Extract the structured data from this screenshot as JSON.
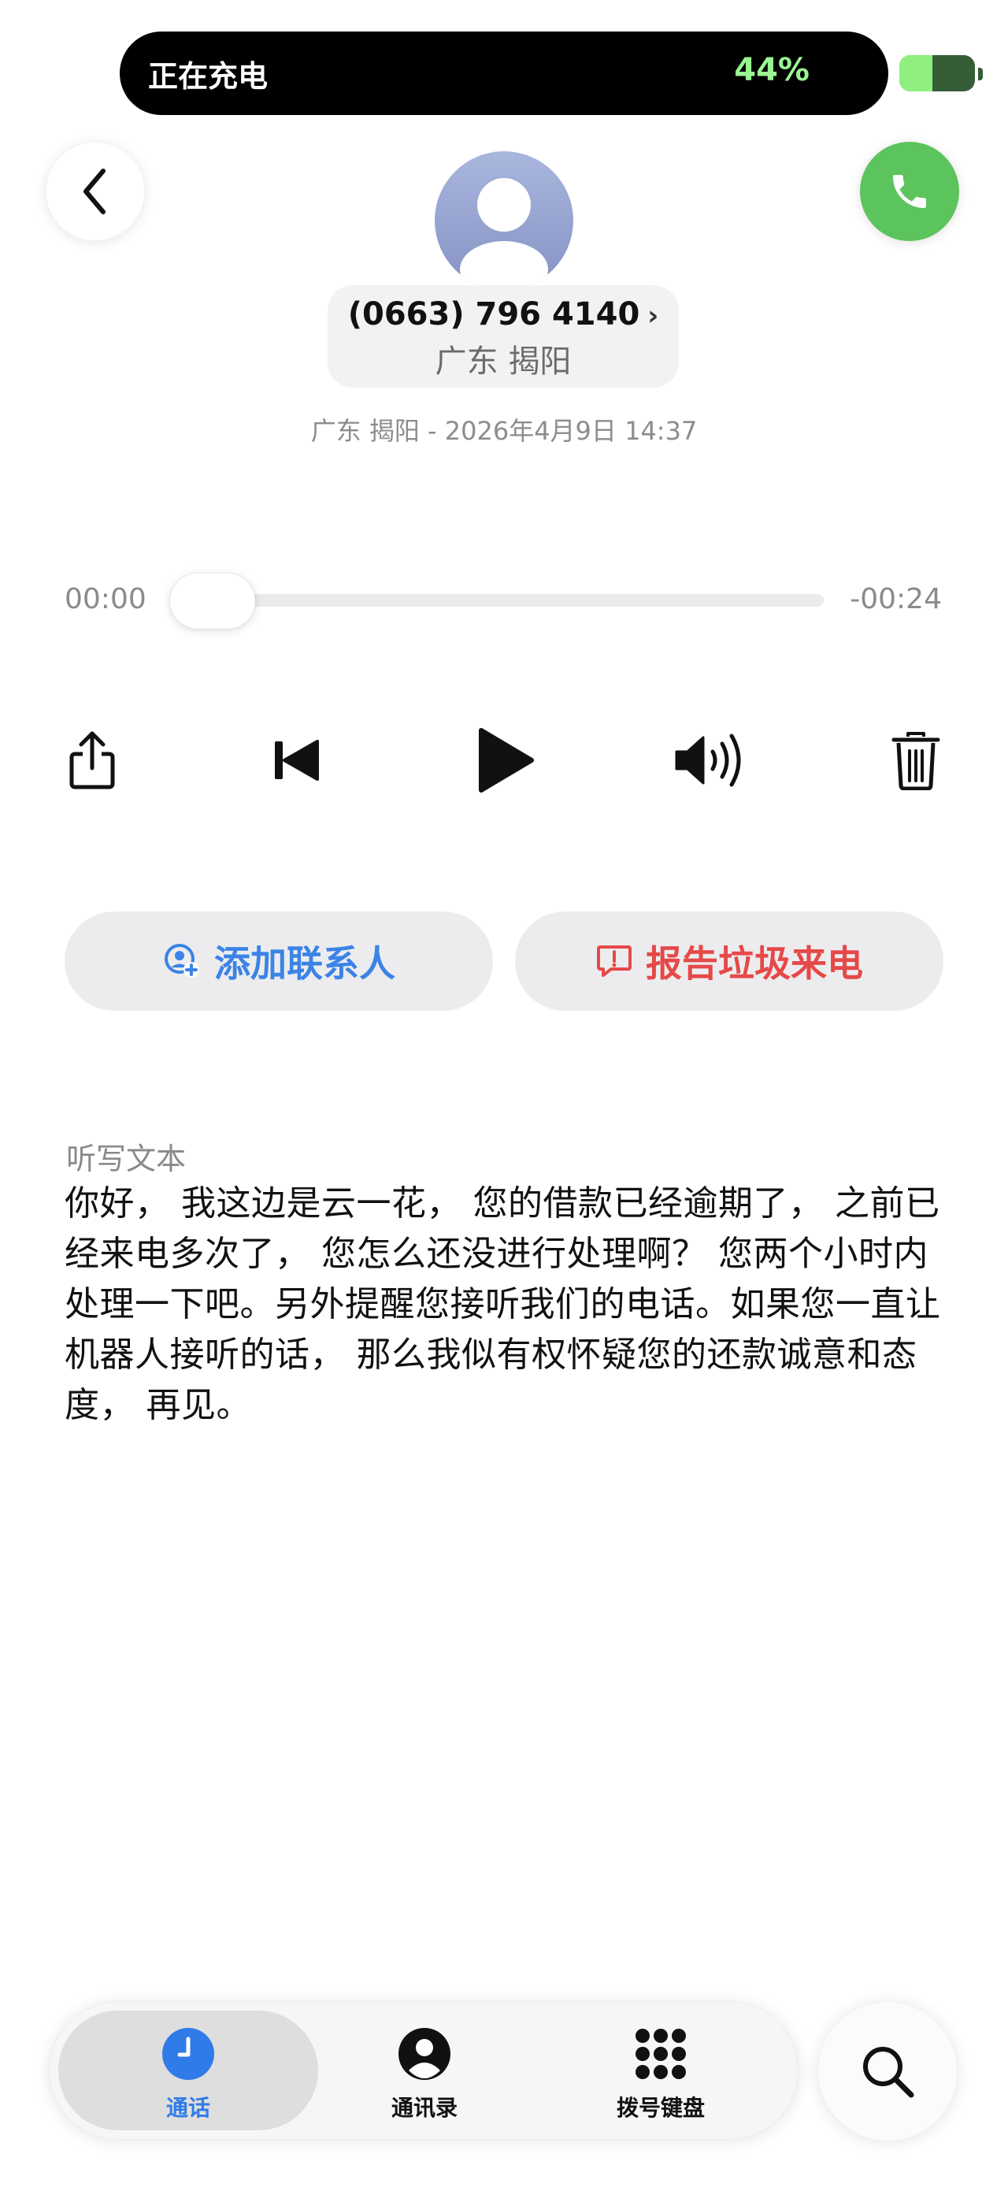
{
  "status": {
    "charging_label": "正在充电",
    "battery_percent_label": "44%",
    "battery_level": 0.44,
    "battery_color": "#8ff07f"
  },
  "header": {
    "back_icon": "chevron-left-icon",
    "call_icon": "phone-icon",
    "call_button_color": "#5cc45c"
  },
  "caller": {
    "avatar_icon": "person-silhouette-icon",
    "number": "(0663) 796 4140",
    "number_chevron": "›",
    "location": "广东 揭阳",
    "meta": "广东 揭阳 - 2026年4月9日 14:37"
  },
  "player": {
    "elapsed": "00:00",
    "remaining": "-00:24",
    "progress": 0,
    "controls": [
      "share-icon",
      "skip-back-icon",
      "play-icon",
      "speaker-icon",
      "trash-icon"
    ]
  },
  "actions": {
    "add_contact": "添加联系人",
    "add_contact_color": "#3b83e7",
    "report_spam": "报告垃圾来电",
    "report_spam_color": "#e64848"
  },
  "transcript": {
    "label": "听写文本",
    "text": "你好， 我这边是云一花， 您的借款已经逾期了， 之前已经来电多次了， 您怎么还没进行处理啊？ 您两个小时内处理一下吧。另外提醒您接听我们的电话。如果您一直让机器人接听的话， 那么我似有权怀疑您的还款诚意和态度， 再见。"
  },
  "tabbar": {
    "tabs": [
      {
        "label": "通话",
        "icon": "clock-icon",
        "active": true
      },
      {
        "label": "通讯录",
        "icon": "contact-circle-icon",
        "active": false
      },
      {
        "label": "拨号键盘",
        "icon": "keypad-icon",
        "active": false
      }
    ],
    "search_icon": "search-icon",
    "active_color": "#2f7be8"
  }
}
